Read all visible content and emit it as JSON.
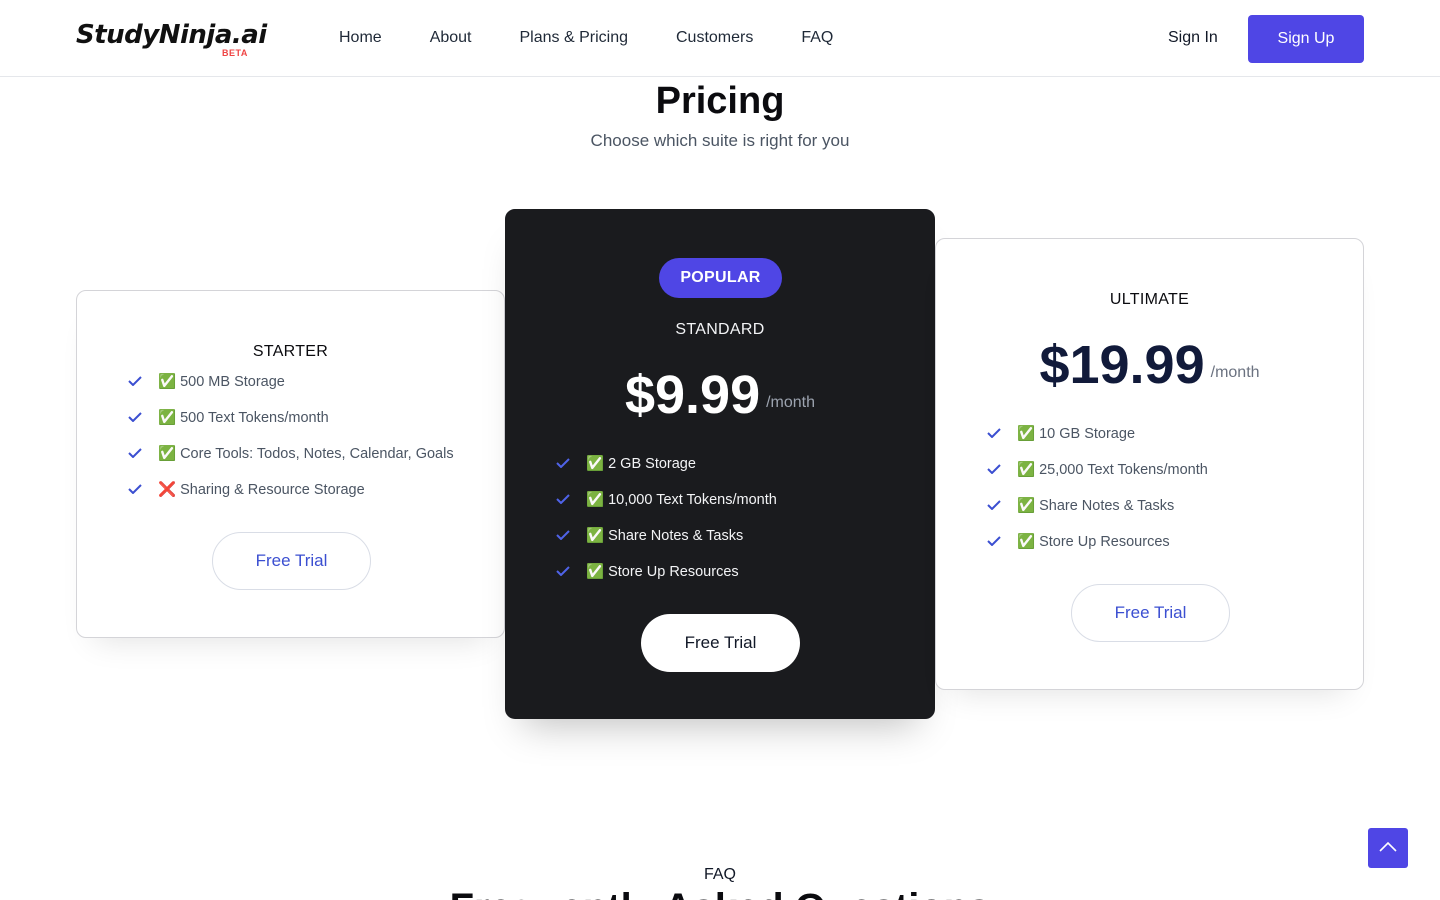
{
  "brand": {
    "name": "StudyNinja.ai",
    "badge": "BETA"
  },
  "nav": {
    "links": [
      "Home",
      "About",
      "Plans & Pricing",
      "Customers",
      "FAQ"
    ],
    "sign_in": "Sign In",
    "sign_up": "Sign Up"
  },
  "pricing": {
    "title": "Pricing",
    "subtitle": "Choose which suite is right for you",
    "plans": [
      {
        "name": "STARTER",
        "features": [
          "✅ 500 MB Storage",
          "✅ 500 Text Tokens/month",
          "✅ Core Tools: Todos, Notes, Calendar, Goals",
          "❌ Sharing & Resource Storage"
        ],
        "cta": "Free Trial"
      },
      {
        "badge": "POPULAR",
        "name": "STANDARD",
        "price": "$9.99",
        "period": "/month",
        "features": [
          "✅ 2 GB Storage",
          "✅ 10,000 Text Tokens/month",
          "✅ Share Notes & Tasks",
          "✅ Store Up Resources"
        ],
        "cta": "Free Trial"
      },
      {
        "name": "ULTIMATE",
        "price": "$19.99",
        "period": "/month",
        "features": [
          "✅ 10 GB Storage",
          "✅ 25,000 Text Tokens/month",
          "✅ Share Notes & Tasks",
          "✅ Store Up Resources"
        ],
        "cta": "Free Trial"
      }
    ]
  },
  "faq": {
    "label": "FAQ",
    "heading": "Frequently Asked Questions"
  },
  "colors": {
    "accent": "#4f46e5",
    "dark_card": "#1a1b1e",
    "check": "#3b4fd1"
  },
  "icons": {
    "feature": "check-icon",
    "scroll": "chevron-up-icon"
  }
}
